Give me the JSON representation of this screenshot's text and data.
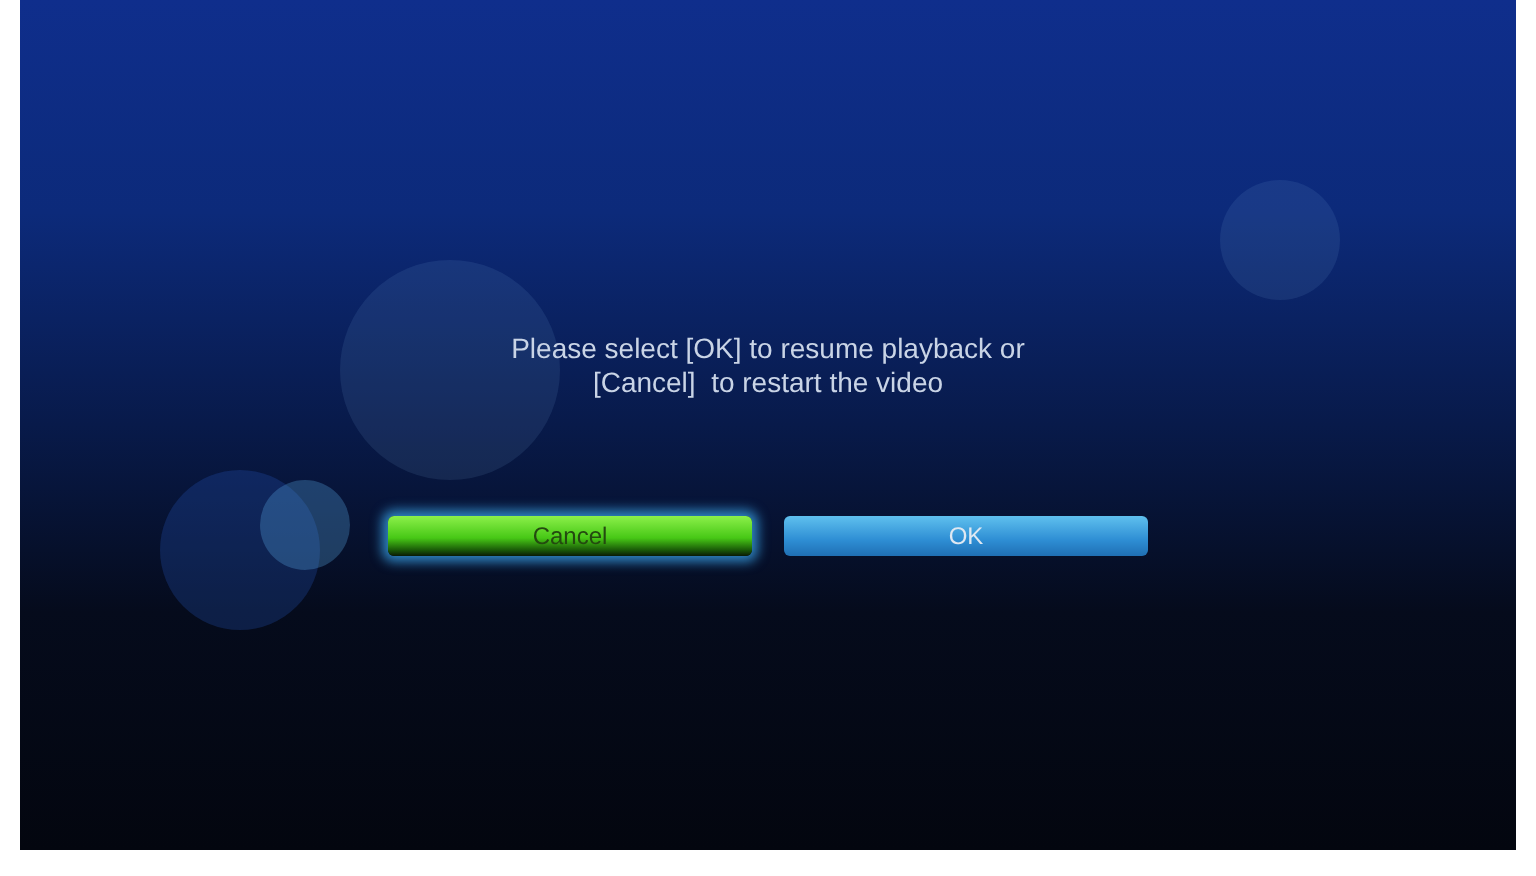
{
  "dialog": {
    "message_lines": [
      "Please select [OK] to resume playback or",
      "[Cancel]  to restart the video"
    ]
  },
  "buttons": [
    {
      "label": "Cancel",
      "selected": true
    },
    {
      "label": "OK",
      "selected": false
    }
  ]
}
